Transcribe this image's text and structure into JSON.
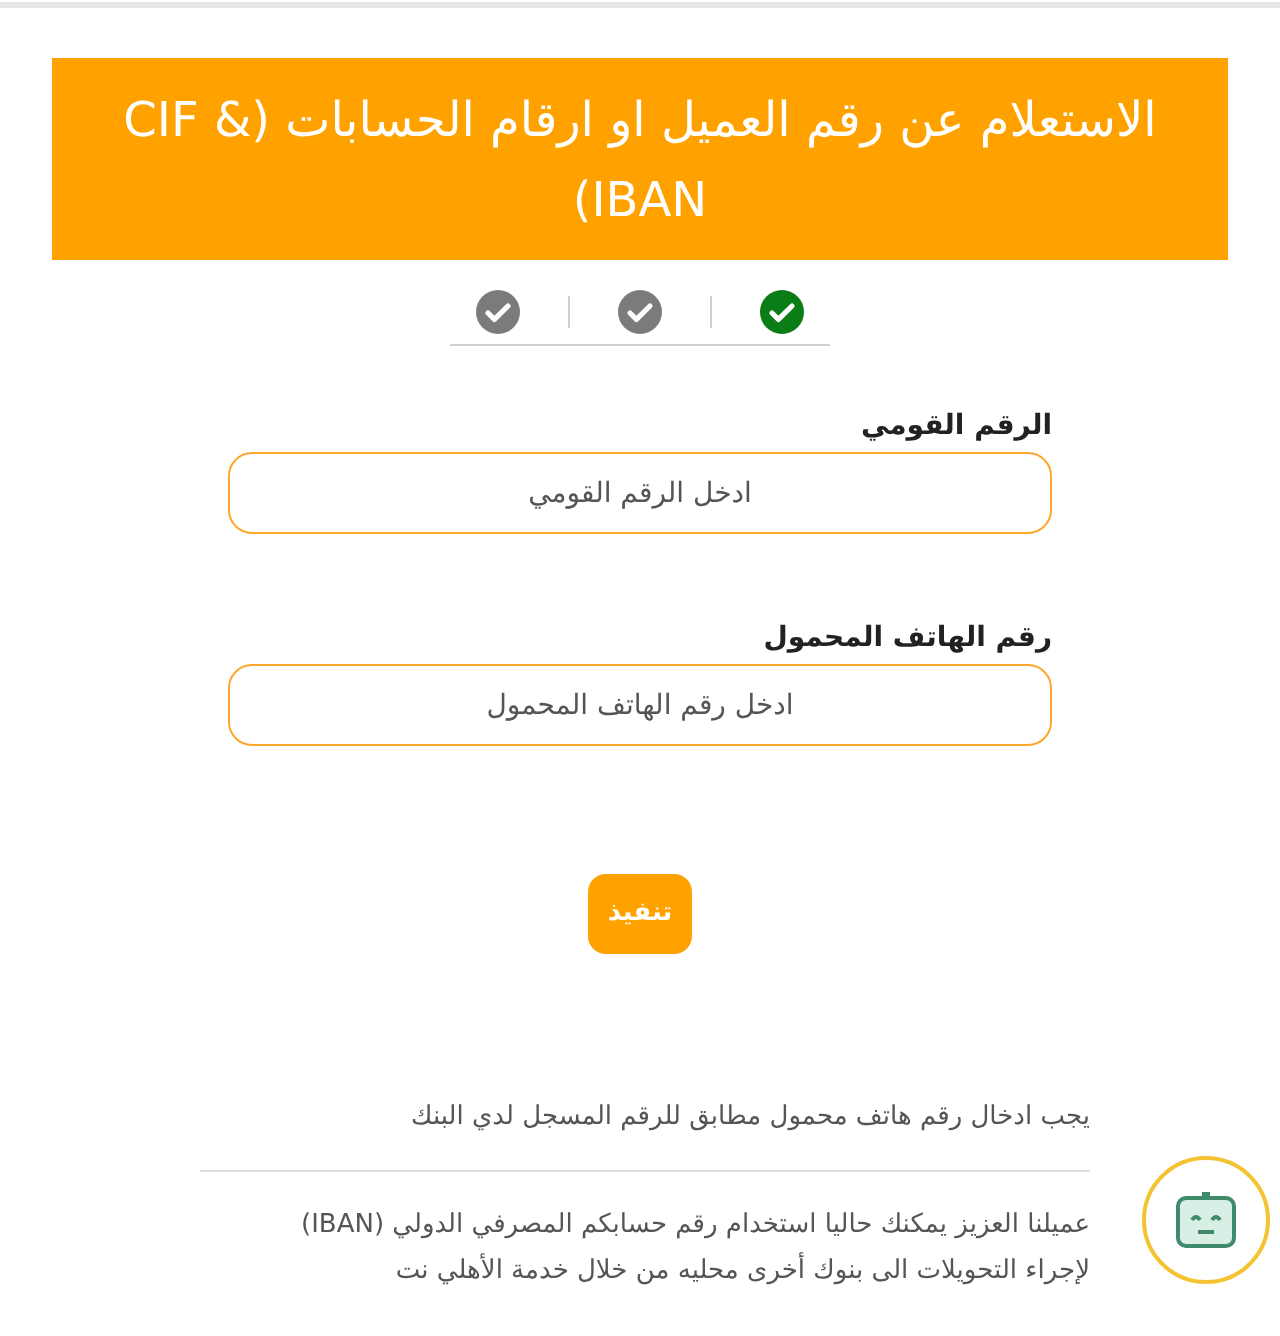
{
  "header": {
    "title": "الاستعلام عن رقم العميل او ارقام الحسابات (CIF & IBAN)"
  },
  "steps": [
    {
      "done": true
    },
    {
      "done": false
    },
    {
      "done": false
    }
  ],
  "fields": [
    {
      "label": "الرقم القومي",
      "placeholder": "ادخل الرقم القومي"
    },
    {
      "label": "رقم الهاتف المحمول",
      "placeholder": "ادخل رقم الهاتف المحمول"
    }
  ],
  "submit_button": "تنفيذ",
  "note": "يجب ادخال رقم هاتف محمول مطابق للرقم المسجل لدي البنك",
  "info_lines": [
    "عميلنا العزيز يمكنك حاليا استخدام رقم حسابكم المصرفي الدولي (IBAN)",
    "لإجراء التحويلات الى بنوك أخرى محليه من خلال خدمة الأهلي نت"
  ]
}
